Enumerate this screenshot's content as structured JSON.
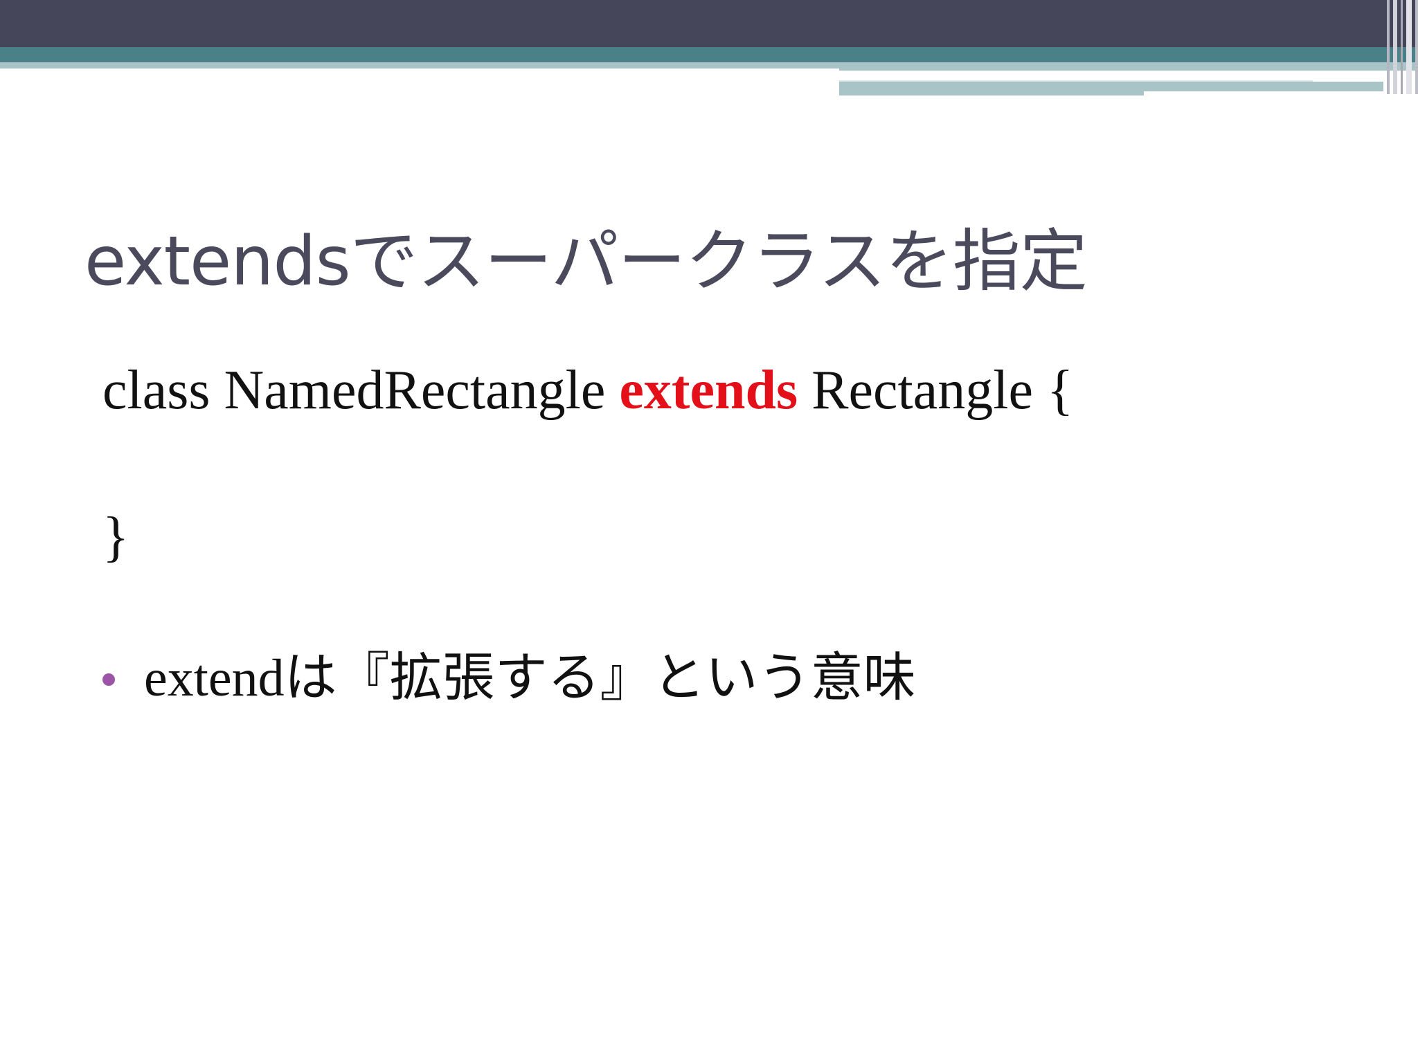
{
  "slide": {
    "title": "extendsでスーパークラスを指定",
    "code": {
      "line1_before": "class NamedRectangle ",
      "line1_keyword": "extends",
      "line1_after": " Rectangle {",
      "line2": "}"
    },
    "bullet": {
      "text": "extendは『拡張する』という意味"
    }
  },
  "colors": {
    "header_dark": "#46465a",
    "header_teal": "#4a8087",
    "header_light": "#a8c4c7",
    "title_text": "#4a4a5c",
    "keyword": "#e3101a",
    "bullet": "#9c54a6"
  }
}
